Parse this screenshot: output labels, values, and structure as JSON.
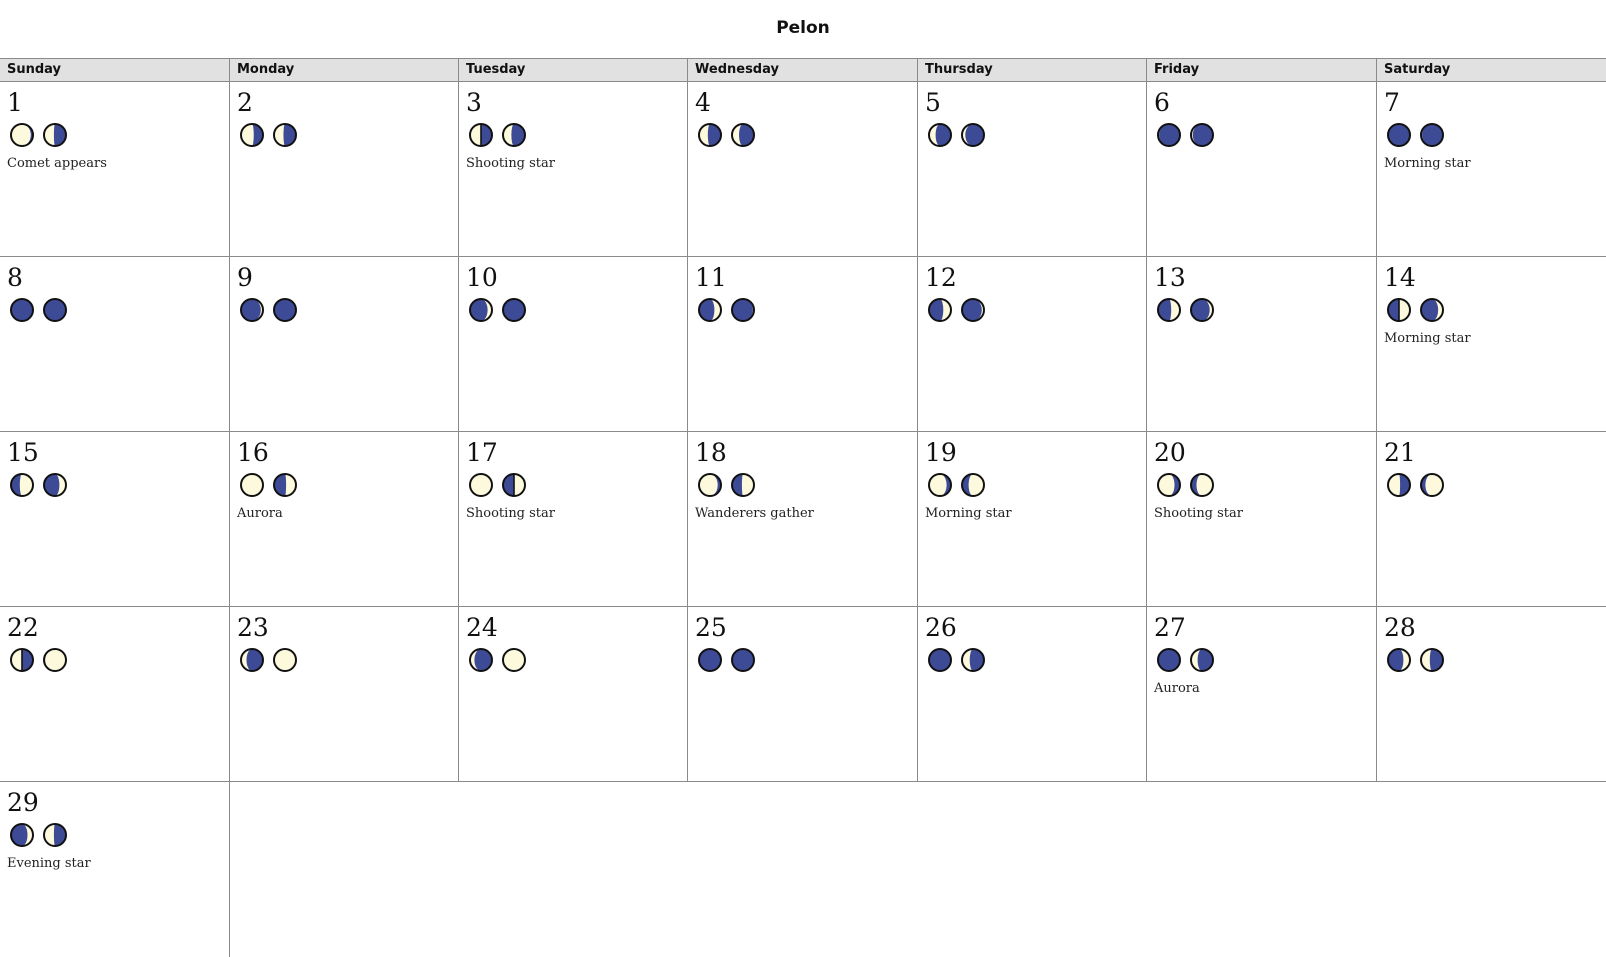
{
  "title": "Pelon",
  "colors": {
    "moon_dark": "#3d4a96",
    "moon_light": "#fdf9dc",
    "moon_outline": "#111111",
    "grid_line": "#8a8a8a",
    "header_bg": "#e1e1e1"
  },
  "weekdays": [
    "Sunday",
    "Monday",
    "Tuesday",
    "Wednesday",
    "Thursday",
    "Friday",
    "Saturday"
  ],
  "weeks": [
    [
      {
        "day": "1",
        "moons": [
          0.1,
          0.55
        ],
        "note": "Comet appears"
      },
      {
        "day": "2",
        "moons": [
          0.42,
          0.57
        ],
        "note": ""
      },
      {
        "day": "3",
        "moons": [
          0.5,
          0.62
        ],
        "note": "Shooting star"
      },
      {
        "day": "4",
        "moons": [
          0.6,
          0.68
        ],
        "note": ""
      },
      {
        "day": "5",
        "moons": [
          0.7,
          0.85
        ],
        "note": ""
      },
      {
        "day": "6",
        "moons": [
          0.95,
          0.92
        ],
        "note": ""
      },
      {
        "day": "7",
        "moons": [
          0.98,
          0.95
        ],
        "note": "Morning star"
      }
    ],
    [
      {
        "day": "8",
        "moons": [
          1.0,
          1.0
        ],
        "note": ""
      },
      {
        "day": "9",
        "moons": [
          1.1,
          1.0
        ],
        "note": ""
      },
      {
        "day": "10",
        "moons": [
          1.2,
          1.02
        ],
        "note": ""
      },
      {
        "day": "11",
        "moons": [
          1.3,
          1.05
        ],
        "note": ""
      },
      {
        "day": "12",
        "moons": [
          1.35,
          1.1
        ],
        "note": ""
      },
      {
        "day": "13",
        "moons": [
          1.4,
          1.15
        ],
        "note": ""
      },
      {
        "day": "14",
        "moons": [
          1.5,
          1.22
        ],
        "note": "Morning star"
      }
    ],
    [
      {
        "day": "15",
        "moons": [
          1.6,
          1.3
        ],
        "note": ""
      },
      {
        "day": "16",
        "moons": [
          1.98,
          1.45
        ],
        "note": "Aurora"
      },
      {
        "day": "17",
        "moons": [
          0.0,
          1.5
        ],
        "note": "Shooting star"
      },
      {
        "day": "18",
        "moons": [
          0.15,
          1.55
        ],
        "note": "Wanderers gather"
      },
      {
        "day": "19",
        "moons": [
          0.2,
          1.7
        ],
        "note": "Morning star"
      },
      {
        "day": "20",
        "moons": [
          0.25,
          1.75
        ],
        "note": "Shooting star"
      },
      {
        "day": "21",
        "moons": [
          0.45,
          1.8
        ],
        "note": ""
      }
    ],
    [
      {
        "day": "22",
        "moons": [
          0.5,
          1.95
        ],
        "note": ""
      },
      {
        "day": "23",
        "moons": [
          0.75,
          2.0
        ],
        "note": ""
      },
      {
        "day": "24",
        "moons": [
          0.8,
          2.0
        ],
        "note": ""
      },
      {
        "day": "25",
        "moons": [
          1.0,
          1.0
        ],
        "note": ""
      },
      {
        "day": "26",
        "moons": [
          1.0,
          0.65
        ],
        "note": ""
      },
      {
        "day": "27",
        "moons": [
          1.0,
          0.7
        ],
        "note": "Aurora"
      },
      {
        "day": "28",
        "moons": [
          1.3,
          0.6
        ],
        "note": ""
      }
    ],
    [
      {
        "day": "29",
        "moons": [
          1.25,
          0.55
        ],
        "note": "Evening star"
      },
      null,
      null,
      null,
      null,
      null,
      null
    ]
  ]
}
